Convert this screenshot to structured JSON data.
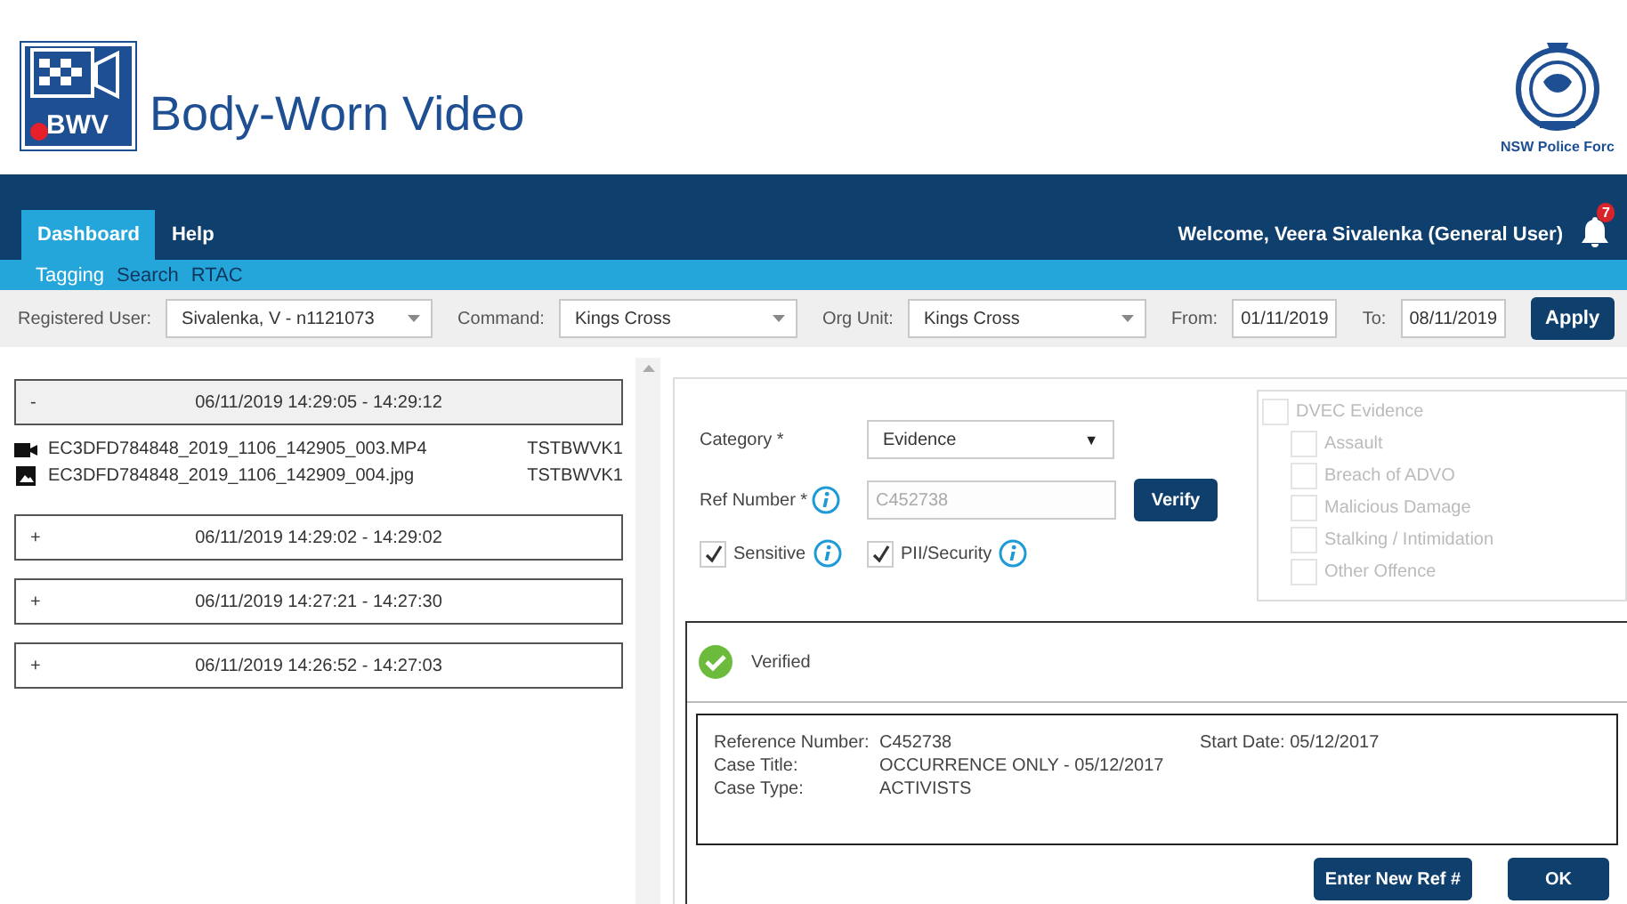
{
  "header": {
    "logo_text": "BWV",
    "title": "Body-Worn Video",
    "org_name": "NSW Police Forc"
  },
  "nav": {
    "tabs": [
      {
        "label": "Dashboard",
        "selected": true
      },
      {
        "label": "Help",
        "selected": false
      }
    ],
    "welcome": "Welcome, Veera Sivalenka (General User)",
    "notification_count": "7",
    "subtabs": [
      {
        "label": "Tagging",
        "selected": true
      },
      {
        "label": "Search",
        "selected": false
      },
      {
        "label": "RTAC",
        "selected": false
      }
    ]
  },
  "filters": {
    "fields": [
      {
        "kind": "select",
        "label": "Registered User:",
        "value": "Sivalenka, V - n1121073"
      },
      {
        "kind": "select",
        "label": "Command:",
        "value": "Kings Cross"
      },
      {
        "kind": "select",
        "label": "Org Unit:",
        "value": "Kings Cross"
      },
      {
        "kind": "date",
        "label": "From:",
        "value": "01/11/2019"
      },
      {
        "kind": "date",
        "label": "To:",
        "value": "08/11/2019"
      }
    ],
    "apply_button": "Apply"
  },
  "groups": [
    {
      "toggle": "-",
      "label": "06/11/2019 14:29:05 - 14:29:12",
      "expanded": true,
      "files": [
        {
          "kind": "video",
          "name": "EC3DFD784848_2019_1106_142905_003.MP4",
          "user": "TSTBWVK1"
        },
        {
          "kind": "image",
          "name": "EC3DFD784848_2019_1106_142909_004.jpg",
          "user": "TSTBWVK1"
        }
      ]
    },
    {
      "toggle": "+",
      "label": "06/11/2019 14:29:02 - 14:29:02",
      "expanded": false
    },
    {
      "toggle": "+",
      "label": "06/11/2019 14:27:21 - 14:27:30",
      "expanded": false
    },
    {
      "toggle": "+",
      "label": "06/11/2019 14:26:52 - 14:27:03",
      "expanded": false
    }
  ],
  "form": {
    "category": {
      "label": "Category *",
      "value": "Evidence",
      "caret": "▼"
    },
    "ref_number": {
      "label": "Ref Number *",
      "value": "C452738",
      "disabled": true
    },
    "verify_button": "Verify",
    "flags": [
      {
        "label": "Sensitive",
        "checked": true
      },
      {
        "label": "PII/Security",
        "checked": true
      }
    ],
    "dvec": {
      "label": "DVEC Evidence",
      "checked": false,
      "disabled": true,
      "items": [
        {
          "label": "Assault",
          "checked": false
        },
        {
          "label": "Breach of ADVO",
          "checked": false
        },
        {
          "label": "Malicious Damage",
          "checked": false
        },
        {
          "label": "Stalking / Intimidation",
          "checked": false
        },
        {
          "label": "Other Offence",
          "checked": false
        }
      ]
    }
  },
  "verification": {
    "status": "Verified",
    "details": [
      {
        "label": "Reference Number:",
        "value": "C452738"
      },
      {
        "label": "Start Date:",
        "value": "05/12/2017"
      },
      {
        "label": "Case Title:",
        "value": "OCCURRENCE ONLY - 05/12/2017"
      },
      {
        "label": "Case Type:",
        "value": "ACTIVISTS"
      }
    ],
    "buttons": [
      "Enter New Ref #",
      "OK"
    ]
  }
}
